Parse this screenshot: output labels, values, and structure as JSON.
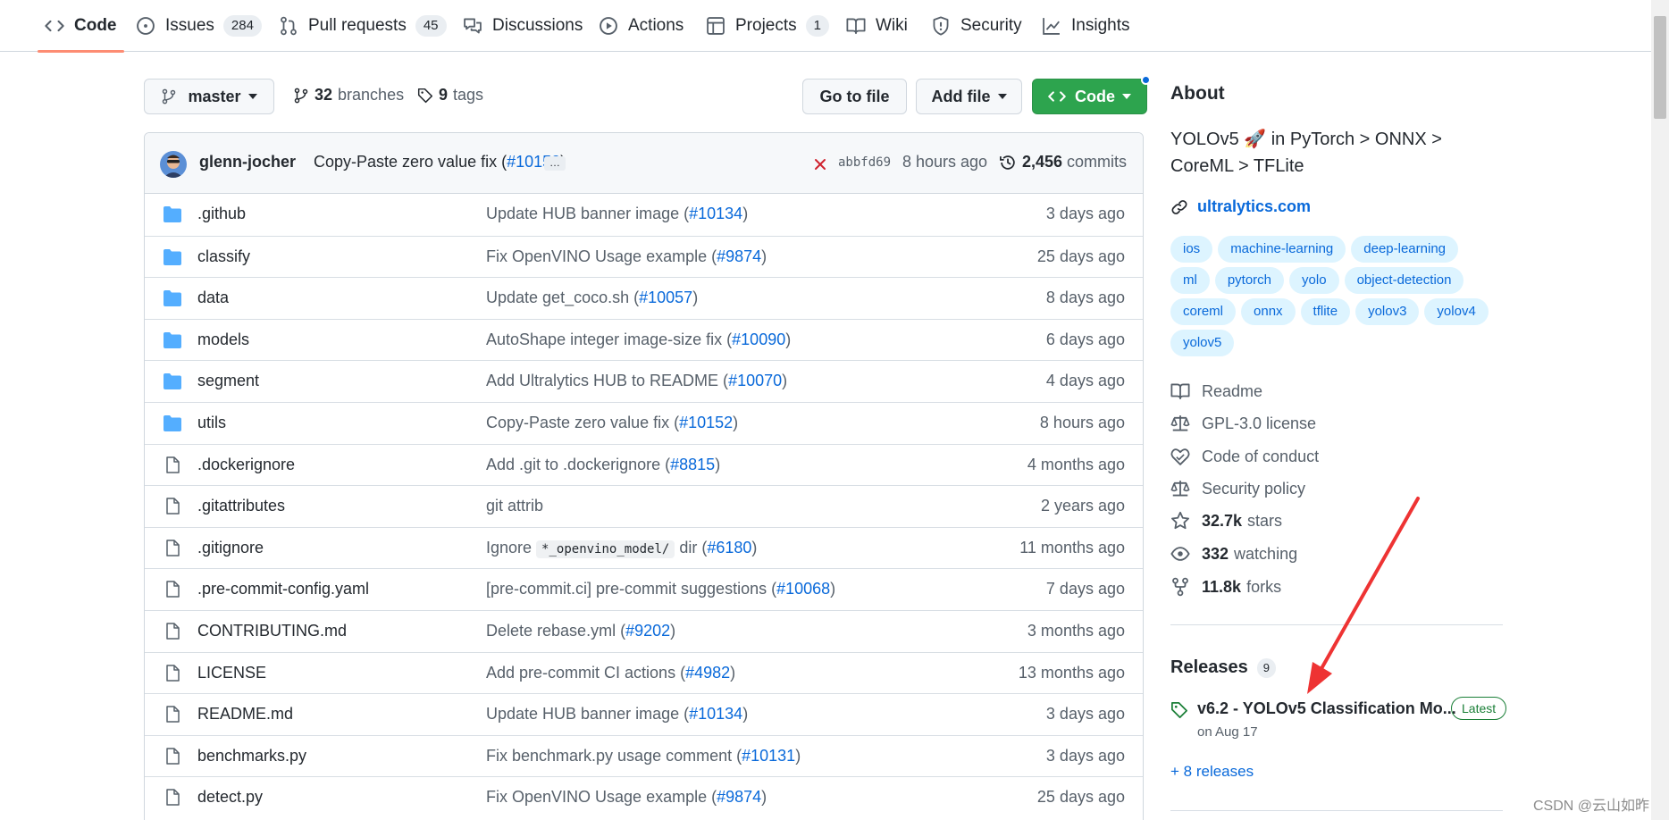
{
  "nav": {
    "tabs": [
      {
        "label": "Code",
        "icon": "code-icon",
        "selected": true
      },
      {
        "label": "Issues",
        "icon": "issue-opened-icon",
        "count": "284"
      },
      {
        "label": "Pull requests",
        "icon": "git-pull-request-icon",
        "count": "45"
      },
      {
        "label": "Discussions",
        "icon": "comment-discussion-icon"
      },
      {
        "label": "Actions",
        "icon": "play-icon"
      },
      {
        "label": "Projects",
        "icon": "table-icon",
        "count": "1"
      },
      {
        "label": "Wiki",
        "icon": "book-icon"
      },
      {
        "label": "Security",
        "icon": "shield-icon"
      },
      {
        "label": "Insights",
        "icon": "graph-icon"
      }
    ]
  },
  "toolbar": {
    "branch": "master",
    "branches_count": "32",
    "branches_label": "branches",
    "tags_count": "9",
    "tags_label": "tags",
    "go_to_file": "Go to file",
    "add_file": "Add file",
    "code": "Code"
  },
  "commit": {
    "author": "glenn-jocher",
    "message": "Copy-Paste zero value fix (",
    "pr": "#10152",
    "message_end": ")",
    "ellipsis": "…",
    "sha": "abbfd69",
    "time": "8 hours ago",
    "commits_count": "2,456",
    "commits_label": "commits"
  },
  "files": [
    {
      "type": "dir",
      "name": ".github",
      "msg": "Update HUB banner image (",
      "pr": "#10134",
      "end": ")",
      "age": "3 days ago"
    },
    {
      "type": "dir",
      "name": "classify",
      "msg": "Fix OpenVINO Usage example (",
      "pr": "#9874",
      "end": ")",
      "age": "25 days ago"
    },
    {
      "type": "dir",
      "name": "data",
      "msg": "Update get_coco.sh (",
      "pr": "#10057",
      "end": ")",
      "age": "8 days ago"
    },
    {
      "type": "dir",
      "name": "models",
      "msg": "AutoShape integer image-size fix (",
      "pr": "#10090",
      "end": ")",
      "age": "6 days ago"
    },
    {
      "type": "dir",
      "name": "segment",
      "msg": "Add Ultralytics HUB to README (",
      "pr": "#10070",
      "end": ")",
      "age": "4 days ago"
    },
    {
      "type": "dir",
      "name": "utils",
      "msg": "Copy-Paste zero value fix (",
      "pr": "#10152",
      "end": ")",
      "age": "8 hours ago"
    },
    {
      "type": "file",
      "name": ".dockerignore",
      "msg": "Add .git to .dockerignore (",
      "pr": "#8815",
      "end": ")",
      "age": "4 months ago"
    },
    {
      "type": "file",
      "name": ".gitattributes",
      "msg": "git attrib",
      "pr": "",
      "end": "",
      "age": "2 years ago"
    },
    {
      "type": "file",
      "name": ".gitignore",
      "msg": "Ignore ",
      "code": "*_openvino_model/",
      "msg2": " dir (",
      "pr": "#6180",
      "end": ")",
      "age": "11 months ago"
    },
    {
      "type": "file",
      "name": ".pre-commit-config.yaml",
      "msg": "[pre-commit.ci] pre-commit suggestions (",
      "pr": "#10068",
      "end": ")",
      "age": "7 days ago"
    },
    {
      "type": "file",
      "name": "CONTRIBUTING.md",
      "msg": "Delete rebase.yml (",
      "pr": "#9202",
      "end": ")",
      "age": "3 months ago"
    },
    {
      "type": "file",
      "name": "LICENSE",
      "msg": "Add pre-commit CI actions (",
      "pr": "#4982",
      "end": ")",
      "age": "13 months ago"
    },
    {
      "type": "file",
      "name": "README.md",
      "msg": "Update HUB banner image (",
      "pr": "#10134",
      "end": ")",
      "age": "3 days ago"
    },
    {
      "type": "file",
      "name": "benchmarks.py",
      "msg": "Fix benchmark.py usage comment (",
      "pr": "#10131",
      "end": ")",
      "age": "3 days ago"
    },
    {
      "type": "file",
      "name": "detect.py",
      "msg": "Fix OpenVINO Usage example (",
      "pr": "#9874",
      "end": ")",
      "age": "25 days ago"
    }
  ],
  "about": {
    "heading": "About",
    "desc_1": "YOLOv5",
    "emoji": "🚀",
    "desc_2": "in PyTorch > ONNX >",
    "desc_3": "CoreML > TFLite",
    "website": "ultralytics.com",
    "topics": [
      "ios",
      "machine-learning",
      "deep-learning",
      "ml",
      "pytorch",
      "yolo",
      "object-detection",
      "coreml",
      "onnx",
      "tflite",
      "yolov3",
      "yolov4",
      "yolov5"
    ],
    "readme": "Readme",
    "license": "GPL-3.0 license",
    "conduct": "Code of conduct",
    "security": "Security policy",
    "stars_count": "32.7k",
    "stars_label": "stars",
    "watching_count": "332",
    "watching_label": "watching",
    "forks_count": "11.8k",
    "forks_label": "forks"
  },
  "releases": {
    "heading": "Releases",
    "count": "9",
    "latest_title": "v6.2 - YOLOv5 Classification Mo...",
    "latest_badge": "Latest",
    "latest_date": "on Aug 17",
    "more": "+ 8 releases"
  },
  "watermark": "CSDN @云山如昨",
  "colors": {
    "accent": "#0969da",
    "primary_button": "#2da44e",
    "nav_underline": "#fd8c73",
    "arrow": "#ee3333",
    "folder": "#54aeff"
  }
}
